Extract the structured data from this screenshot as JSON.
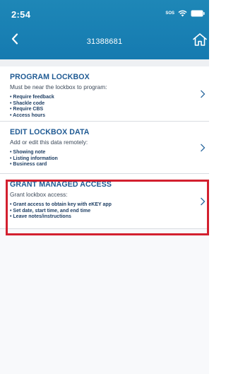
{
  "status": {
    "time": "2:54",
    "sos": "SOS"
  },
  "nav": {
    "title": "31388681"
  },
  "sections": [
    {
      "title": "PROGRAM LOCKBOX",
      "subtitle": "Must be near the lockbox to program:",
      "bullets": [
        "• Require feedback",
        "• Shackle code",
        "• Require CBS",
        "• Access hours"
      ]
    },
    {
      "title": "EDIT LOCKBOX DATA",
      "subtitle": "Add or edit this data remotely:",
      "bullets": [
        "• Showing note",
        "• Listing information",
        "• Business card"
      ]
    },
    {
      "title": "GRANT MANAGED ACCESS",
      "subtitle": "Grant lockbox access:",
      "bullets": [
        "• Grant access to obtain key with eKEY app",
        "• Set date, start time, and end time",
        "• Leave notes/instructions"
      ]
    }
  ],
  "colors": {
    "header": "#1a82b5",
    "title": "#1f5a93",
    "highlight": "#d3202f"
  },
  "icons": [
    "back-chevron-icon",
    "home-icon",
    "wifi-icon",
    "battery-icon",
    "chevron-right-icon"
  ]
}
